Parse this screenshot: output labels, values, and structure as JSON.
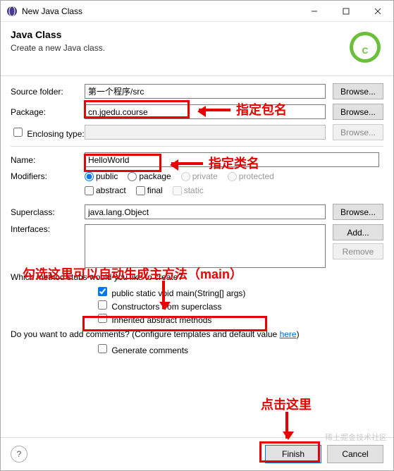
{
  "window": {
    "title": "New Java Class"
  },
  "header": {
    "title": "Java Class",
    "subtitle": "Create a new Java class."
  },
  "fields": {
    "source_folder_label": "Source folder:",
    "source_folder_value": "第一个程序/src",
    "package_label": "Package:",
    "package_value": "cn.jgedu.course",
    "enclosing_label": "Enclosing type:",
    "name_label": "Name:",
    "name_value": "HelloWorld",
    "modifiers_label": "Modifiers:",
    "superclass_label": "Superclass:",
    "superclass_value": "java.lang.Object",
    "interfaces_label": "Interfaces:"
  },
  "modifiers": {
    "public": "public",
    "package": "package",
    "private": "private",
    "protected": "protected",
    "abstract": "abstract",
    "final": "final",
    "static": "static"
  },
  "buttons": {
    "browse": "Browse...",
    "add": "Add...",
    "remove": "Remove",
    "finish": "Finish",
    "cancel": "Cancel"
  },
  "stubs": {
    "question": "Which method stubs would you like to create?",
    "main": "public static void main(String[] args)",
    "constructors": "Constructors from superclass",
    "inherited": "Inherited abstract methods"
  },
  "comments": {
    "question_a": "Do you want to add comments? (Configure templates and default value ",
    "here": "here",
    "question_b": ")",
    "generate": "Generate comments"
  },
  "annotations": {
    "pkg": "指定包名",
    "cls": "指定类名",
    "main": "勾选这里可以自动生成主方法（main）",
    "finish": "点击这里"
  },
  "watermark": "稀土掘金技术社区"
}
